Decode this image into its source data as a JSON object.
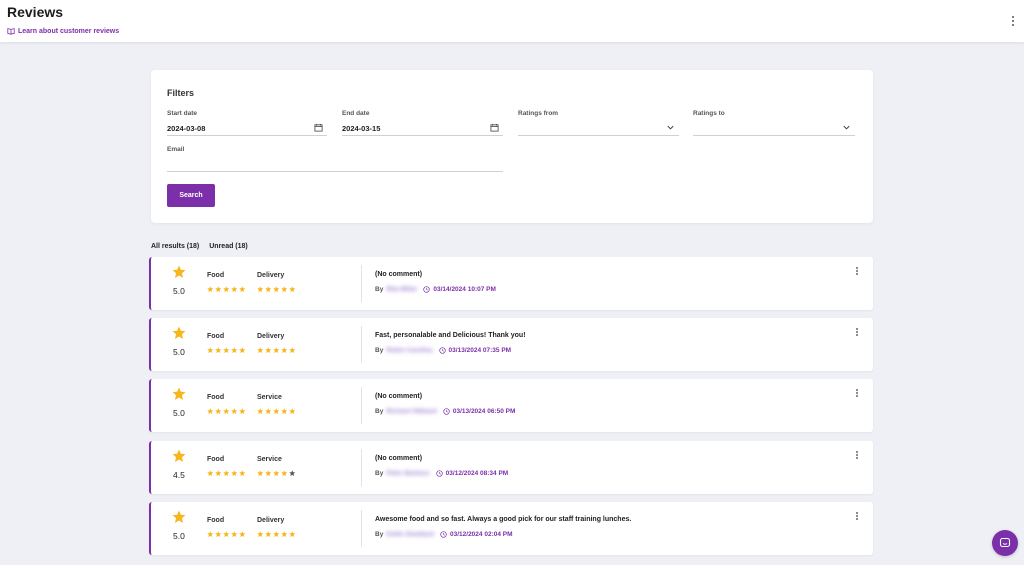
{
  "header": {
    "title": "Reviews",
    "learn_link": "Learn about customer reviews"
  },
  "filters": {
    "title": "Filters",
    "start_date": {
      "label": "Start date",
      "value": "2024-03-08"
    },
    "end_date": {
      "label": "End date",
      "value": "2024-03-15"
    },
    "ratings_from": {
      "label": "Ratings from",
      "value": ""
    },
    "ratings_to": {
      "label": "Ratings to",
      "value": ""
    },
    "email": {
      "label": "Email",
      "value": ""
    },
    "search_label": "Search"
  },
  "tabs": [
    {
      "label": "All results (18)"
    },
    {
      "label": "Unread (18)"
    }
  ],
  "reviews": [
    {
      "score": "5.0",
      "cat1": "Food",
      "cat1_rating": 5,
      "cat2": "Delivery",
      "cat2_rating": 5,
      "comment": "(No comment)",
      "by": "By",
      "author": "Rita Miller",
      "date": "03/14/2024 10:07 PM"
    },
    {
      "score": "5.0",
      "cat1": "Food",
      "cat1_rating": 5,
      "cat2": "Delivery",
      "cat2_rating": 5,
      "comment": "Fast, personalable and Delicious! Thank you!",
      "by": "By",
      "author": "Robin Carolina",
      "date": "03/13/2024 07:35 PM"
    },
    {
      "score": "5.0",
      "cat1": "Food",
      "cat1_rating": 5,
      "cat2": "Service",
      "cat2_rating": 5,
      "comment": "(No comment)",
      "by": "By",
      "author": "Richard Hibbard",
      "date": "03/13/2024 06:50 PM"
    },
    {
      "score": "4.5",
      "cat1": "Food",
      "cat1_rating": 5,
      "cat2": "Service",
      "cat2_rating": 4,
      "comment": "(No comment)",
      "by": "By",
      "author": "Peter Barbour",
      "date": "03/12/2024 08:34 PM"
    },
    {
      "score": "5.0",
      "cat1": "Food",
      "cat1_rating": 5,
      "cat2": "Delivery",
      "cat2_rating": 5,
      "comment": "Awesome food and so fast. Always a good pick for our staff training lunches.",
      "by": "By",
      "author": "Kellie Stoddard",
      "date": "03/12/2024 02:04 PM"
    }
  ],
  "colors": {
    "accent": "#7b2fa8",
    "star": "#f6b61c",
    "star_empty": "#5a5a5a"
  },
  "icons": {
    "learn": "book-icon",
    "calendar": "calendar-icon",
    "chevron": "chevron-down-icon",
    "star": "star-icon",
    "clock": "clock-icon",
    "menu": "kebab-menu-icon",
    "chat": "chat-icon"
  }
}
